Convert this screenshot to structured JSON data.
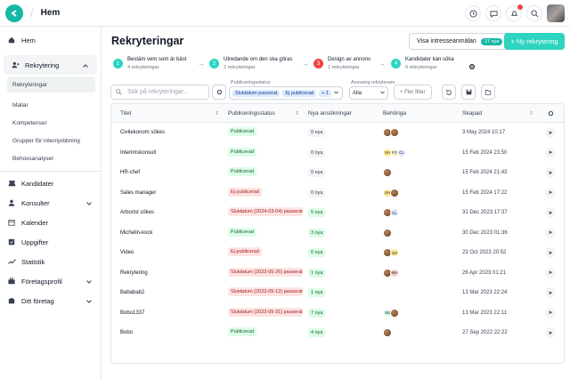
{
  "topbar": {
    "breadcrumb": "Hem"
  },
  "sidebar": {
    "items": [
      {
        "label": "Hem"
      },
      {
        "label": "Rekrytering"
      },
      {
        "label": "Kandidater"
      },
      {
        "label": "Konsulter"
      },
      {
        "label": "Kalender"
      },
      {
        "label": "Uppgifter"
      },
      {
        "label": "Statistik"
      },
      {
        "label": "Företagsprofil"
      },
      {
        "label": "Ditt företag"
      }
    ],
    "sub_items": [
      {
        "label": "Rekryteringar"
      },
      {
        "label": "Mallar"
      },
      {
        "label": "Kompetenser"
      },
      {
        "label": "Grupper för internjobbning"
      },
      {
        "label": "Behovsanalyser"
      }
    ]
  },
  "main": {
    "title": "Rekryteringar",
    "visa_button": "Visa intresseanmälan",
    "visa_badge": "17 nya",
    "new_button": "+ Ny rekrytering",
    "steps": [
      {
        "num": "1",
        "title": "Bestäm vem som är bäst",
        "sub": "4 rekryteringar",
        "color": "#2dd4bf"
      },
      {
        "num": "2",
        "title": "Utredande om den ska göras",
        "sub": "2 rekryteringar",
        "color": "#2dd4bf"
      },
      {
        "num": "3",
        "title": "Design av annons",
        "sub": "1 rekryteringar",
        "color": "#ef4444"
      },
      {
        "num": "4",
        "title": "Kandidater kan söka",
        "sub": "0 rekryteringar",
        "color": "#2dd4bf"
      }
    ]
  },
  "filters": {
    "search_placeholder": "Sök på rekryteringar...",
    "status_label": "Publiceringsstatus",
    "status_chip1": "Slutdatum passerat",
    "status_chip2": "Ej publicerad",
    "status_more": "+ 1",
    "user_label": "Ansvarig rekryterare",
    "user_value": "Alla",
    "more_filters": "+ Fler filter"
  },
  "table": {
    "headers": [
      "Titel",
      "Publiceringsstatus",
      "Nya ansökningar",
      "Behöriga",
      "Skapad"
    ],
    "rows": [
      {
        "title": "Civilekonom sökes",
        "status": "Publicerad",
        "type": "pub",
        "nya": "0 nya",
        "created": "3 May 2024 10:17",
        "avatars": [
          "photo",
          "photo"
        ]
      },
      {
        "title": "Interimskonsult",
        "status": "Publicerad",
        "type": "pub",
        "nya": "0 nya",
        "created": "15 Feb 2024 23:50",
        "avatars": [
          "SH",
          "FO",
          "CL"
        ]
      },
      {
        "title": "HR-chef",
        "status": "Publicerad",
        "type": "pub",
        "nya": "0 nya",
        "created": "15 Feb 2024 21:43",
        "avatars": [
          "photo"
        ]
      },
      {
        "title": "Sales manager",
        "status": "Ej publicerad",
        "type": "ej",
        "nya": "0 nya",
        "created": "15 Feb 2024 17:22",
        "avatars": [
          "SH",
          "photo"
        ]
      },
      {
        "title": "Arborist sökes",
        "status": "Slutdatum (2024-03-04) passerat",
        "type": "ej",
        "nya": "5 nya",
        "created": "31 Dec 2023 17:37",
        "avatars": [
          "photo",
          "CL"
        ]
      },
      {
        "title": "Michelin-kock",
        "status": "Publicerad",
        "type": "pub",
        "nya": "3 nya",
        "created": "30 Dec 2023 01:36",
        "avatars": [
          "photo"
        ]
      },
      {
        "title": "Video",
        "status": "Ej publicerad",
        "type": "ej",
        "nya": "6 nya",
        "created": "23 Oct 2023 20:52",
        "avatars": [
          "photo",
          "SH"
        ]
      },
      {
        "title": "Rekrytering",
        "status": "Slutdatum (2023-05-26) passerat",
        "type": "ej",
        "nya": "1 nya",
        "created": "26 Apr 2023 01:21",
        "avatars": [
          "photo",
          "MH"
        ]
      },
      {
        "title": "Bababab2",
        "status": "Slutdatum (2023-05-12) passerat",
        "type": "ej",
        "nya": "1 nya",
        "created": "13 Mar 2023 22:24",
        "avatars": []
      },
      {
        "title": "Bobo1337",
        "status": "Slutdatum (2023-05-31) passerat",
        "type": "ej",
        "nya": "7 nya",
        "created": "13 Mar 2023 22:11",
        "avatars": [
          "SB",
          "photo"
        ]
      },
      {
        "title": "Bobo",
        "status": "Publicerad",
        "type": "pub",
        "nya": "4 nya",
        "created": "27 Sep 2022 22:22",
        "avatars": [
          "photo"
        ]
      },
      {
        "title": "",
        "status": "",
        "type": "pub",
        "nya": "",
        "created": "",
        "avatars": []
      }
    ]
  },
  "colors": {
    "accent": "#2dd4bf",
    "danger": "#ef4444"
  }
}
